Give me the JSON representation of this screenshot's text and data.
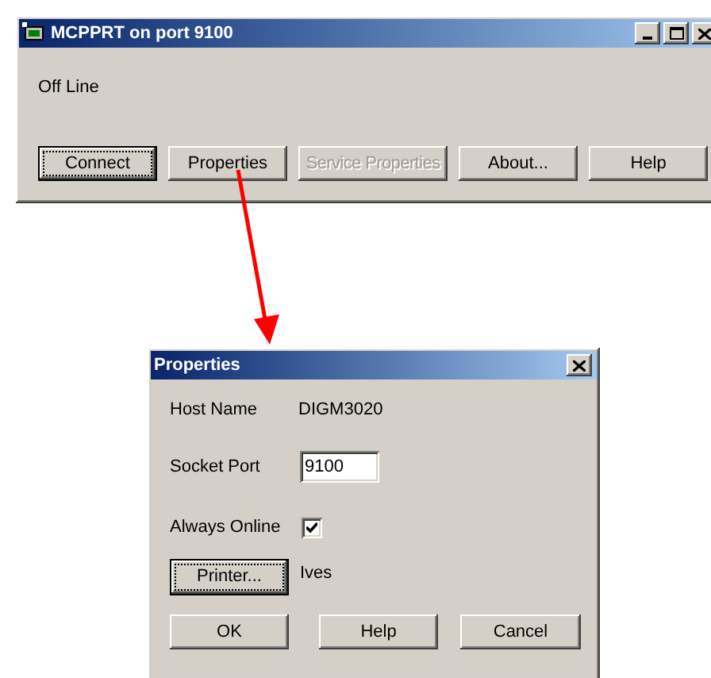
{
  "main_window": {
    "title": "MCPPRT on port 9100",
    "status": "Off Line",
    "buttons": [
      {
        "label": "Connect",
        "default": true,
        "disabled": false
      },
      {
        "label": "Properties",
        "default": false,
        "disabled": false
      },
      {
        "label": "Service Properties",
        "default": false,
        "disabled": true
      },
      {
        "label": "About...",
        "default": false,
        "disabled": false
      },
      {
        "label": "Help",
        "default": false,
        "disabled": false
      }
    ]
  },
  "properties_dialog": {
    "title": "Properties",
    "host_name": {
      "label": "Host Name",
      "value": "DIGM3020"
    },
    "socket_port": {
      "label": "Socket Port",
      "value": "9100"
    },
    "always_online": {
      "label": "Always Online",
      "checked": true
    },
    "printer": {
      "button": "Printer...",
      "default": true,
      "value": "Ives"
    },
    "buttons": [
      {
        "label": "OK"
      },
      {
        "label": "Help"
      },
      {
        "label": "Cancel"
      }
    ]
  }
}
